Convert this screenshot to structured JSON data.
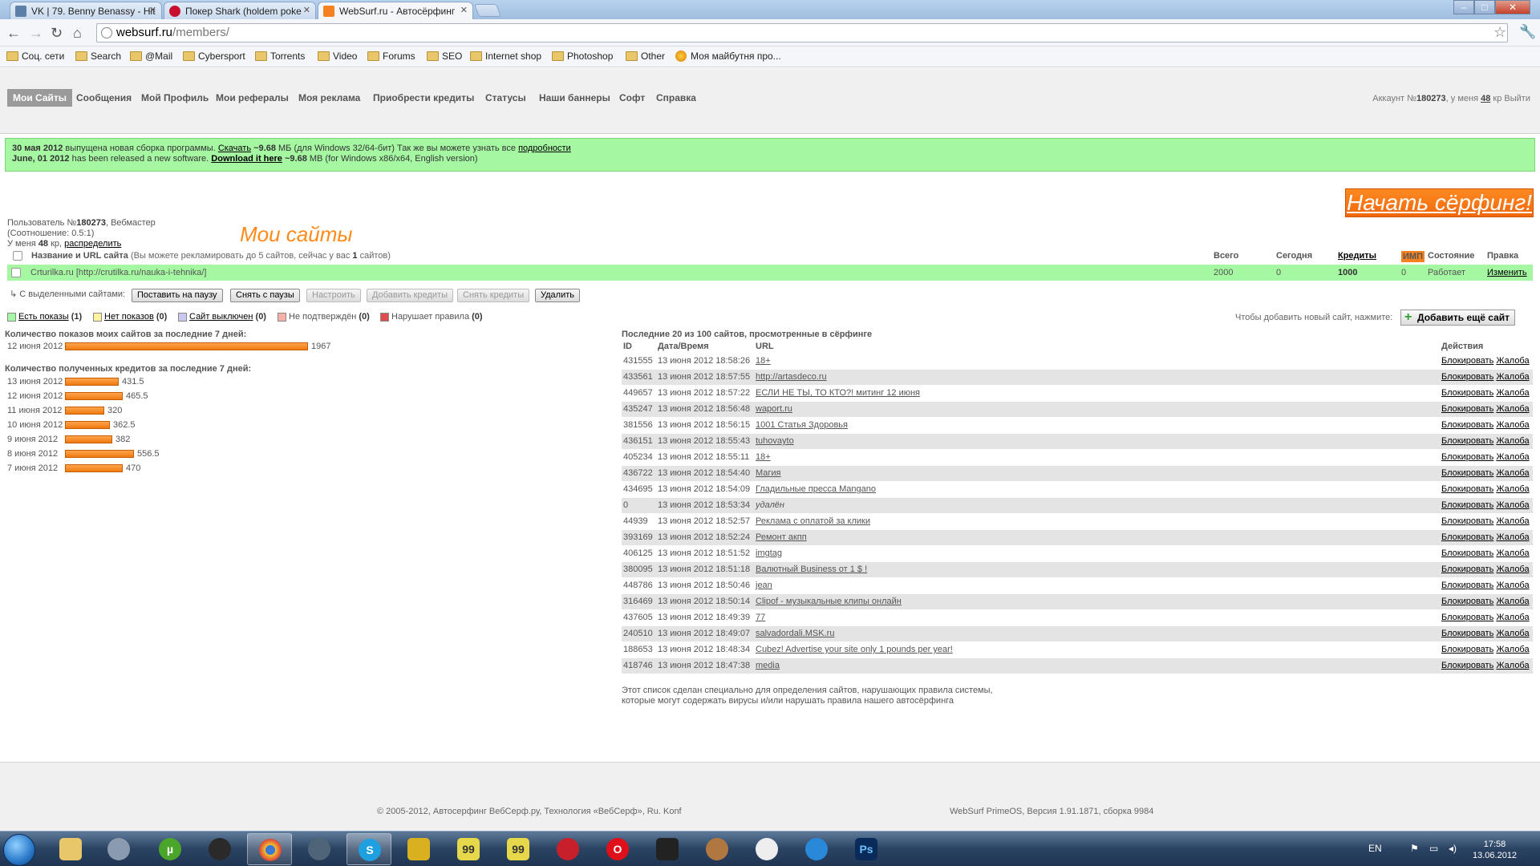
{
  "browser": {
    "tabs": [
      {
        "title": "VK | 79. Benny Benassy - Hit",
        "color": "#5b7fa6"
      },
      {
        "title": "Покер Shark (holdem poke",
        "color": "#c8102e"
      },
      {
        "title": "WebSurf.ru - Автосёрфинг",
        "color": "#f58220"
      }
    ],
    "url_host": "websurf.ru",
    "url_path": "/members/",
    "bookmarks": [
      "Соц. сети",
      "Search",
      "@Mail",
      "Cybersport",
      "Torrents",
      "Video",
      "Forums",
      "SEO",
      "Internet shop",
      "Photoshop",
      "Other",
      "Моя майбутня про..."
    ]
  },
  "nav": {
    "items": [
      "Мои Сайты",
      "Сообщения",
      "Мой Профиль",
      "Мои рефералы",
      "Моя реклама",
      "Приобрести кредиты",
      "Статусы",
      "Наши баннеры",
      "Софт",
      "Справка"
    ],
    "account_prefix": "Аккаунт №",
    "account_id": "180273",
    "account_mid": ", у меня ",
    "credits": "48",
    "account_suffix": " кр",
    "logout": "Выйти"
  },
  "notice": {
    "line1_date": "30 мая 2012",
    "line1_text": " выпущена новая сборка программы. ",
    "line1_link": "Скачать",
    "line1_size": " ~9.68",
    "line1_rest": " МБ (для Windows 32/64-бит) Так же вы можете узнать все ",
    "line1_more": "подробности",
    "line2_date": "June, 01 2012",
    "line2_text": " has been released a new software. ",
    "line2_link": "Download it here",
    "line2_size": " ~9.68",
    "line2_rest": " MB (for Windows x86/x64, English version)"
  },
  "start_button": "Начать сёрфинг!",
  "user": {
    "prefix": "Пользователь №",
    "id": "180273",
    "role": ", Вебмастер",
    "ratio": "(Соотношение: 0.5:1)",
    "credits_prefix": "У меня ",
    "credits": "48",
    "credits_suffix": " кр, ",
    "distribute": "распределить"
  },
  "my_sites_title": "Мои сайты",
  "sites_table": {
    "col_name": "Название и URL сайта",
    "col_name_hint_pre": " (Вы можете рекламировать до 5 сайтов, сейчас у вас ",
    "col_name_hint_count": "1",
    "col_name_hint_post": " сайтов)",
    "col_total": "Всего",
    "col_today": "Сегодня",
    "col_credits": "Кредиты",
    "col_imp": "ИМП",
    "col_state": "Состояние",
    "col_edit": "Правка",
    "rows": [
      {
        "name": "Crturilka.ru [http://crutilka.ru/nauka-i-tehnika/]",
        "total": "2000",
        "today": "0",
        "credits": "1000",
        "imp": "0",
        "state": "Работает",
        "edit": "Изменить"
      }
    ]
  },
  "bulk": {
    "label": "С выделенными сайтами:",
    "buttons": [
      "Поставить на паузу",
      "Снять с паузы",
      "Настроить",
      "Добавить кредиты",
      "Снять кредиты",
      "Удалить"
    ]
  },
  "legend": [
    {
      "label": "Есть показы",
      "count": "(1)",
      "color": "#a5f7a2",
      "link": true
    },
    {
      "label": "Нет показов",
      "count": "(0)",
      "color": "#fff3a0",
      "link": true
    },
    {
      "label": "Сайт выключен",
      "count": "(0)",
      "color": "#c8c8f0",
      "link": true
    },
    {
      "label": "Не подтверждён",
      "count": "(0)",
      "color": "#f7b0a8",
      "link": false
    },
    {
      "label": "Нарушает правила",
      "count": "(0)",
      "color": "#e04b4b",
      "link": false
    }
  ],
  "add_site": {
    "note": "Чтобы добавить новый сайт, нажмите:",
    "button": "Добавить ещё сайт"
  },
  "chart_data": [
    {
      "type": "bar",
      "title": "Количество показов моих сайтов за последние 7 дней:",
      "categories": [
        "12 июня 2012"
      ],
      "values": [
        1967
      ]
    },
    {
      "type": "bar",
      "title": "Количество полученных кредитов за последние 7 дней:",
      "categories": [
        "13 июня 2012",
        "12 июня 2012",
        "11 июня 2012",
        "10 июня 2012",
        "9 июня 2012",
        "8 июня 2012",
        "7 июня 2012"
      ],
      "values": [
        431.5,
        465.5,
        320,
        362.5,
        382,
        556.5,
        470
      ]
    }
  ],
  "recent": {
    "title": "Последние 20 из 100 сайтов, просмотренные в сёрфинге",
    "col_id": "ID",
    "col_dt": "Дата/Время",
    "col_url": "URL",
    "col_actions": "Действия",
    "block": "Блокировать",
    "report": "Жалоба",
    "rows": [
      {
        "id": "431555",
        "dt": "13 июня 2012 18:58:26",
        "url": "18+"
      },
      {
        "id": "433561",
        "dt": "13 июня 2012 18:57:55",
        "url": "http://artasdeco.ru"
      },
      {
        "id": "449657",
        "dt": "13 июня 2012 18:57:22",
        "url": "ЕСЛИ НЕ ТЫ, ТО КТО?! митинг 12 июня"
      },
      {
        "id": "435247",
        "dt": "13 июня 2012 18:56:48",
        "url": "waport.ru"
      },
      {
        "id": "381556",
        "dt": "13 июня 2012 18:56:15",
        "url": "1001 Статья Здоровья"
      },
      {
        "id": "436151",
        "dt": "13 июня 2012 18:55:43",
        "url": "tuhovayto"
      },
      {
        "id": "405234",
        "dt": "13 июня 2012 18:55:11",
        "url": "18+"
      },
      {
        "id": "436722",
        "dt": "13 июня 2012 18:54:40",
        "url": "Магия"
      },
      {
        "id": "434695",
        "dt": "13 июня 2012 18:54:09",
        "url": "Гладильные пресса Mangano"
      },
      {
        "id": "0",
        "dt": "13 июня 2012 18:53:34",
        "url": "удалён"
      },
      {
        "id": "44939",
        "dt": "13 июня 2012 18:52:57",
        "url": "Реклама с оплатой за клики"
      },
      {
        "id": "393169",
        "dt": "13 июня 2012 18:52:24",
        "url": "Ремонт акпп"
      },
      {
        "id": "406125",
        "dt": "13 июня 2012 18:51:52",
        "url": "imgtag"
      },
      {
        "id": "380095",
        "dt": "13 июня 2012 18:51:18",
        "url": "Валютный Business от 1 $ !"
      },
      {
        "id": "448786",
        "dt": "13 июня 2012 18:50:46",
        "url": "jean"
      },
      {
        "id": "316469",
        "dt": "13 июня 2012 18:50:14",
        "url": "Clipof - музыкальные клипы онлайн"
      },
      {
        "id": "437605",
        "dt": "13 июня 2012 18:49:39",
        "url": "77"
      },
      {
        "id": "240510",
        "dt": "13 июня 2012 18:49:07",
        "url": "salvadordali.MSK.ru"
      },
      {
        "id": "188653",
        "dt": "13 июня 2012 18:48:34",
        "url": "Cubez! Advertise your site only 1 pounds per year!"
      },
      {
        "id": "418746",
        "dt": "13 июня 2012 18:47:38",
        "url": "media"
      }
    ],
    "note_line1": "Этот список сделан специально для определения сайтов, нарушающих правила системы,",
    "note_line2": "которые могут содержать вирусы и/или нарушать правила нашего автосёрфинга"
  },
  "footer": {
    "left": "© 2005-2012, Автосерфинг ВебСерф.ру,  Технология «ВебСерф», Ru. Konf",
    "right": "WebSurf PrimeOS, Версия 1.91.1871, сборка 9984"
  },
  "taskbar": {
    "lang": "EN",
    "time": "17:58",
    "date": "13.06.2012"
  }
}
